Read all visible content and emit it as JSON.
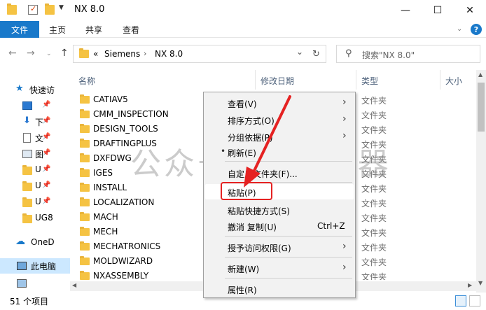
{
  "window": {
    "title": "NX 8.0",
    "minimize_glyph": "—",
    "maximize_glyph": "☐",
    "close_glyph": "✕"
  },
  "ribbon": {
    "file_tab": "文件",
    "tabs": [
      "主页",
      "共享",
      "查看"
    ]
  },
  "address": {
    "overflow": "«",
    "crumbs": [
      "Siemens",
      "NX 8.0"
    ],
    "crumb_sep": "›",
    "dropdown_glyph": "⌄",
    "refresh_glyph": "↻"
  },
  "search": {
    "placeholder": "搜索\"NX 8.0\""
  },
  "nav": {
    "items": [
      {
        "label": "快速访",
        "icon": "star-icon"
      },
      {
        "label": "",
        "icon": "desktop-icon"
      },
      {
        "label": "下",
        "icon": "download-icon"
      },
      {
        "label": "文",
        "icon": "document-icon"
      },
      {
        "label": "图",
        "icon": "picture-icon"
      },
      {
        "label": "U",
        "icon": "folder-icon"
      },
      {
        "label": "U",
        "icon": "folder-icon"
      },
      {
        "label": "U",
        "icon": "folder-icon"
      },
      {
        "label": "UG8",
        "icon": "folder-icon"
      },
      {
        "label": "OneD",
        "icon": "cloud-icon"
      },
      {
        "label": "此电脑",
        "icon": "computer-icon"
      },
      {
        "label": "",
        "icon": "network-icon"
      }
    ]
  },
  "columns": {
    "name": "名称",
    "date": "修改日期",
    "type": "类型",
    "size": "大小"
  },
  "files": [
    {
      "name": "CATIAV5",
      "type": "文件夹"
    },
    {
      "name": "CMM_INSPECTION",
      "type": "文件夹"
    },
    {
      "name": "DESIGN_TOOLS",
      "type": "文件夹"
    },
    {
      "name": "DRAFTINGPLUS",
      "type": "文件夹"
    },
    {
      "name": "DXFDWG",
      "type": "文件夹"
    },
    {
      "name": "IGES",
      "type": "文件夹"
    },
    {
      "name": "INSTALL",
      "type": "文件夹"
    },
    {
      "name": "LOCALIZATION",
      "type": "文件夹"
    },
    {
      "name": "MACH",
      "type": "文件夹"
    },
    {
      "name": "MECH",
      "type": "文件夹"
    },
    {
      "name": "MECHATRONICS",
      "type": "文件夹"
    },
    {
      "name": "MOLDWIZARD",
      "type": "文件夹"
    },
    {
      "name": "NXASSEMBLY",
      "type": "文件夹"
    }
  ],
  "status": {
    "count": "51 个项目"
  },
  "context_menu": {
    "view": "查看(V)",
    "sort": "排序方式(O)",
    "group": "分组依据(P)",
    "refresh": "刷新(E)",
    "customize": "自定义文件夹(F)...",
    "paste": "粘贴(P)",
    "paste_shortcut": "粘贴快捷方式(S)",
    "undo": "撤消 复制(U)",
    "undo_shortcut": "Ctrl+Z",
    "grant_access": "授予访问权限(G)",
    "new": "新建(W)",
    "properties": "属性(R)",
    "submenu_glyph": "›",
    "bullet_glyph": "•"
  },
  "watermark": "公众号: 开源神器",
  "colors": {
    "accent": "#1979ca",
    "selection": "#cce8ff",
    "annotation": "#e52222",
    "folder": "#f5c343"
  }
}
